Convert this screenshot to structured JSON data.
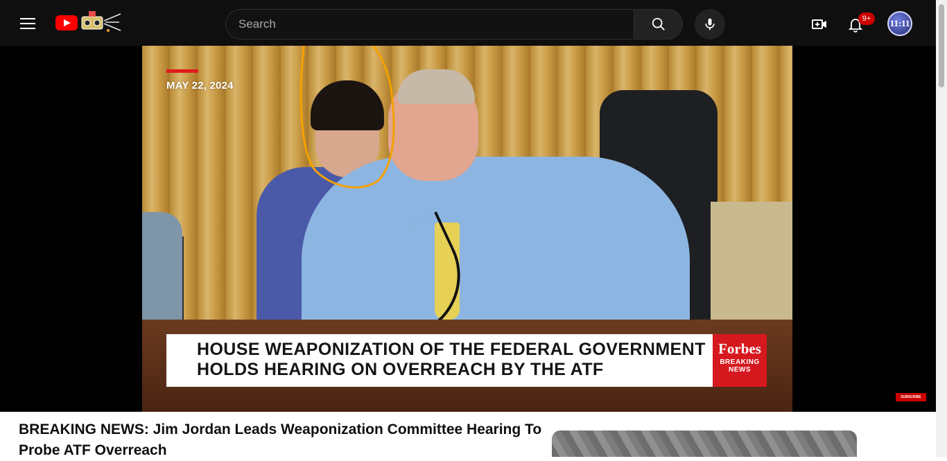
{
  "header": {
    "search": {
      "placeholder": "Search"
    },
    "notifications_badge": "9+",
    "avatar_text": "11:11"
  },
  "video": {
    "overlay_date": "MAY 22, 2024",
    "lower_third_line1": "HOUSE WEAPONIZATION OF THE FEDERAL GOVERNMENT",
    "lower_third_line2": "HOLDS HEARING ON OVERREACH BY THE ATF",
    "brand": "Forbes",
    "brand_sub1": "BREAKING",
    "brand_sub2": "NEWS",
    "subscribe_label": "SUBSCRIBE"
  },
  "title": "BREAKING NEWS: Jim Jordan Leads Weaponization Committee Hearing To Probe ATF Overreach",
  "colors": {
    "topbar": "#0f0f0f",
    "youtube_red": "#ff0000",
    "badge_red": "#cc0000",
    "annotation_orange": "#f5a100"
  }
}
